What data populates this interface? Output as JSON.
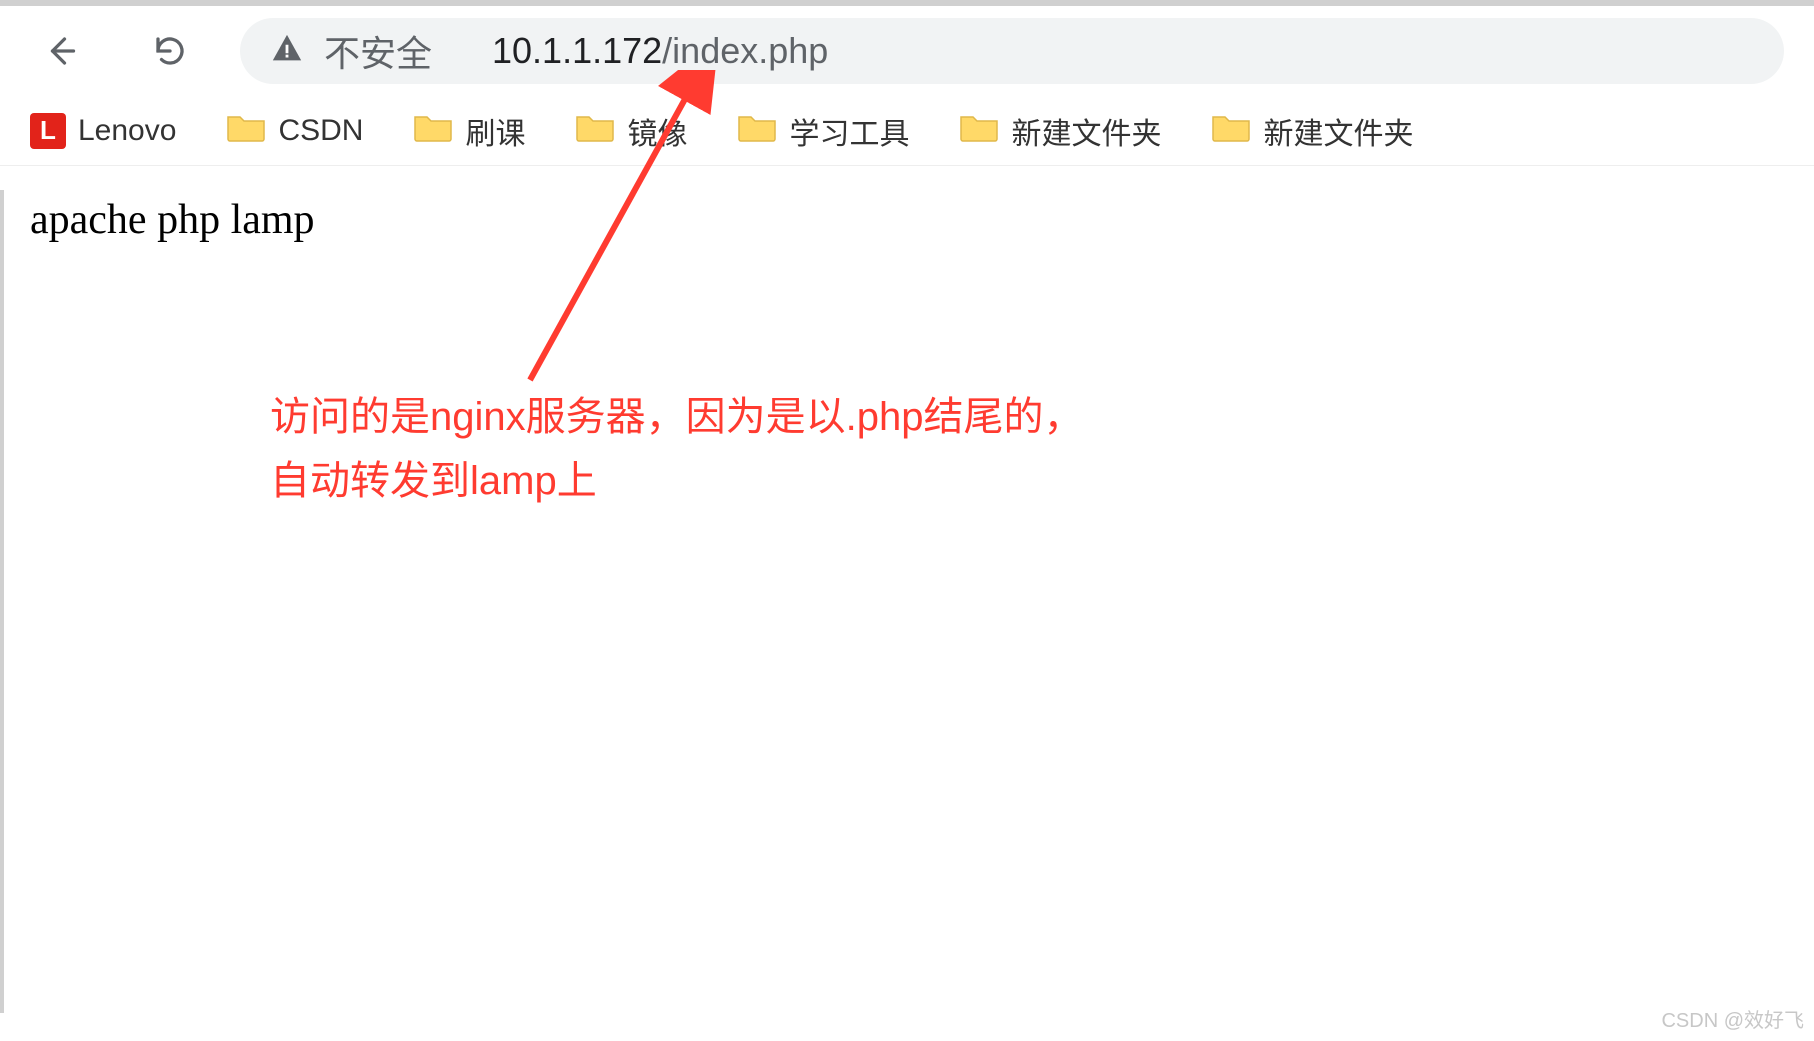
{
  "toolbar": {
    "not_secure_label": "不安全",
    "url_host": "10.1.1.172",
    "url_path": "/index.php"
  },
  "bookmarks": [
    {
      "type": "site",
      "label": "Lenovo"
    },
    {
      "type": "folder",
      "label": "CSDN"
    },
    {
      "type": "folder",
      "label": "刷课"
    },
    {
      "type": "folder",
      "label": "镜像"
    },
    {
      "type": "folder",
      "label": "学习工具"
    },
    {
      "type": "folder",
      "label": "新建文件夹"
    },
    {
      "type": "folder",
      "label": "新建文件夹"
    }
  ],
  "page": {
    "body_text": "apache php lamp"
  },
  "annotation": {
    "line1": "访问的是nginx服务器，因为是以.php结尾的，",
    "line2": "自动转发到lamp上"
  },
  "watermark": "CSDN @效好飞"
}
